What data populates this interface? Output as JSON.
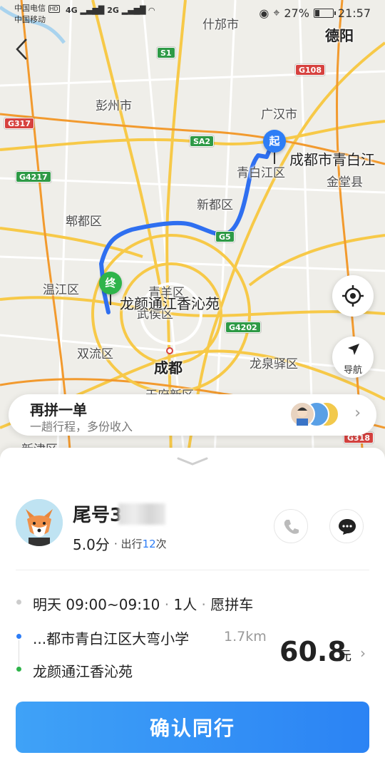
{
  "status": {
    "carrier1": "中国电信",
    "carrier1_badge": "HD",
    "carrier2": "中国移动",
    "signal1": "4G",
    "signal2": "2G",
    "battery_text": "27%",
    "battery_level": 0.27,
    "time": "21:57"
  },
  "map": {
    "places": [
      "什邡市",
      "德阳",
      "彭州市",
      "广汉市",
      "青白江区",
      "金堂县",
      "郫都区",
      "新都区",
      "温江区",
      "武侯区",
      "青羊区",
      "双流区",
      "成都",
      "龙泉驿区",
      "天府新区",
      "新津区"
    ],
    "roads": [
      "S1",
      "G108",
      "G317",
      "SA2",
      "G4217",
      "G5",
      "G4202",
      "G318"
    ],
    "start_marker": "起",
    "end_marker": "终",
    "start_label": "成都市青白江",
    "end_label": "龙颜通江香沁苑"
  },
  "controls": {
    "nav_label": "导航"
  },
  "banner": {
    "title": "再拼一单",
    "subtitle": "一趟行程，多份收入"
  },
  "driver": {
    "name": "尾号3",
    "score": "5.0分",
    "trips_prefix": "出行",
    "trips_count": "12",
    "trips_suffix": "次"
  },
  "trip": {
    "time": "明天 09:00~09:10",
    "people": "1人",
    "pool": "愿拼车",
    "from": "...都市青白江区大弯小学",
    "distance": "1.7km",
    "to": "龙颜通江香沁苑",
    "price": "60.8",
    "unit": "元"
  },
  "confirm_label": "确认同行",
  "colors": {
    "route": "#2f6ff0",
    "start": "#2d7df6",
    "end": "#2eb44a",
    "accent": "#2b83f4"
  }
}
